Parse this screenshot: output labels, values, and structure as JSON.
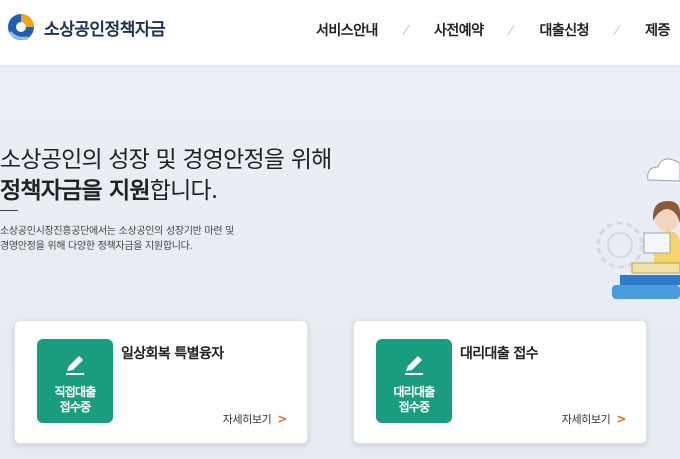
{
  "header": {
    "logo_text": "소상공인정책자금",
    "nav": [
      {
        "label": "서비스안내"
      },
      {
        "label": "사전예약"
      },
      {
        "label": "대출신청"
      },
      {
        "label": "제증"
      }
    ],
    "separator": "/"
  },
  "hero": {
    "title_line1": "소상공인의 성장 및 경영안정을 위해",
    "title_line2_bold": "정책자금을 지원",
    "title_line2_rest": "합니다.",
    "desc_line1": "소상공인시장진흥공단에서는 소상공인의 성장기반 마련 및",
    "desc_line2": "경영안정을 위해 다양한 정책자금을 지원합니다."
  },
  "cards": [
    {
      "badge_line1": "직접대출",
      "badge_line2": "접수중",
      "title": "일상회복 특별융자",
      "more": "자세히보기"
    },
    {
      "badge_line1": "대리대출",
      "badge_line2": "접수중",
      "title": "대리대출 접수",
      "more": "자세히보기"
    }
  ],
  "colors": {
    "accent_green": "#1a9d7f",
    "chevron_orange": "#e06a1b",
    "logo_blue": "#1e5fb4",
    "logo_orange": "#f5a21b"
  },
  "icons": {
    "logo": "logo-icon",
    "badge": "pencil-icon",
    "more": "chevron-right-icon"
  }
}
